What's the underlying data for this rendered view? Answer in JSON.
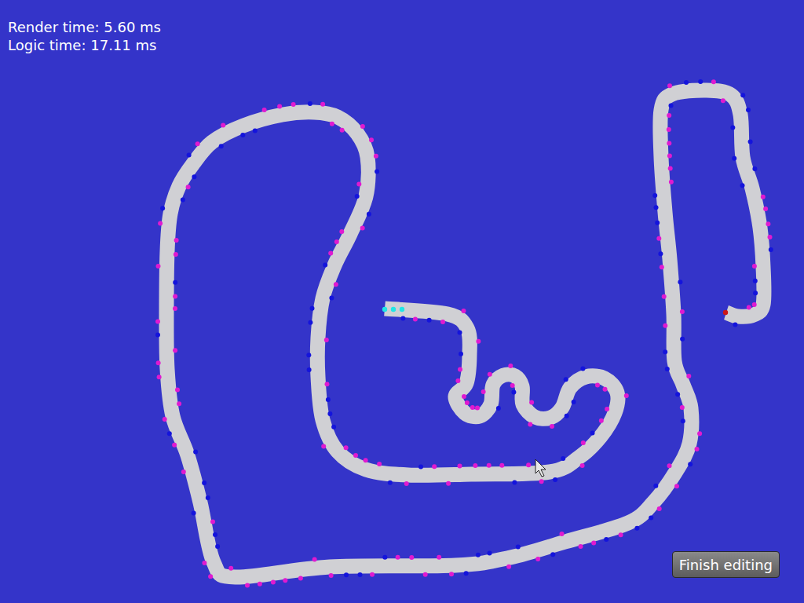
{
  "stats": {
    "render_time": "Render time: 5.60 ms",
    "logic_time": "Logic time: 17.11 ms"
  },
  "buttons": [
    {
      "label": "Finish editing"
    }
  ]
}
